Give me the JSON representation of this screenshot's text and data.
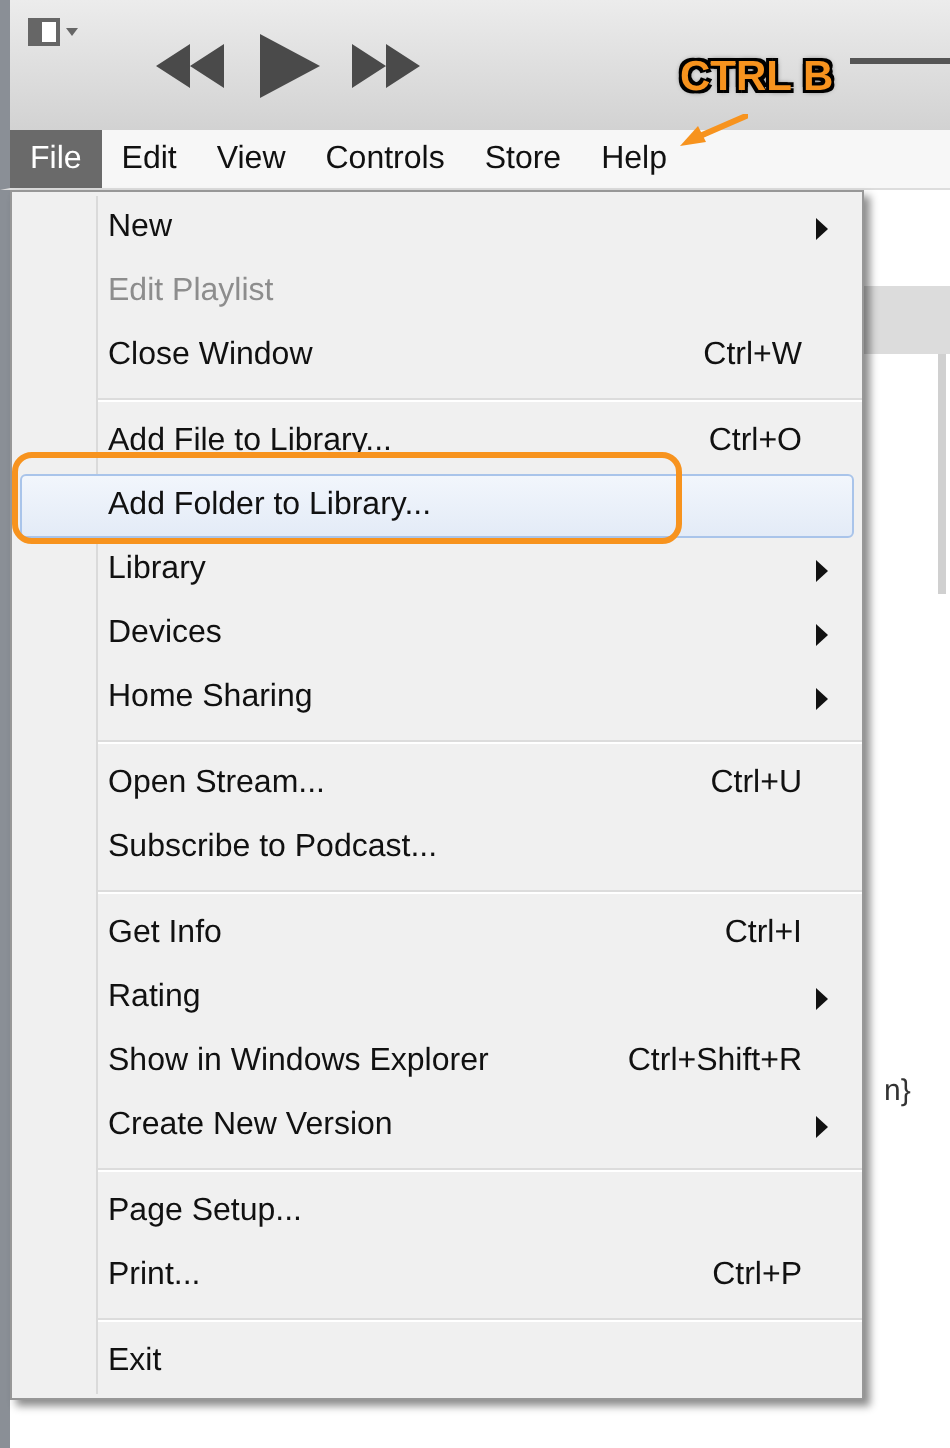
{
  "menubar": [
    {
      "label": "File",
      "selected": true
    },
    {
      "label": "Edit",
      "selected": false
    },
    {
      "label": "View",
      "selected": false
    },
    {
      "label": "Controls",
      "selected": false
    },
    {
      "label": "Store",
      "selected": false
    },
    {
      "label": "Help",
      "selected": false
    }
  ],
  "annotation": {
    "label": "CTRL B"
  },
  "menu": [
    {
      "kind": "item",
      "label": "New",
      "submenu": true,
      "disabled": false,
      "selected": false
    },
    {
      "kind": "item",
      "label": "Edit Playlist",
      "submenu": false,
      "disabled": true,
      "selected": false
    },
    {
      "kind": "item",
      "label": "Close Window",
      "shortcut": "Ctrl+W",
      "submenu": false,
      "disabled": false,
      "selected": false
    },
    {
      "kind": "separator"
    },
    {
      "kind": "item",
      "label": "Add File to Library...",
      "shortcut": "Ctrl+O",
      "submenu": false,
      "disabled": false,
      "selected": false
    },
    {
      "kind": "item",
      "label": "Add Folder to Library...",
      "submenu": false,
      "disabled": false,
      "selected": true
    },
    {
      "kind": "item",
      "label": "Library",
      "submenu": true,
      "disabled": false,
      "selected": false
    },
    {
      "kind": "item",
      "label": "Devices",
      "submenu": true,
      "disabled": false,
      "selected": false
    },
    {
      "kind": "item",
      "label": "Home Sharing",
      "submenu": true,
      "disabled": false,
      "selected": false
    },
    {
      "kind": "separator"
    },
    {
      "kind": "item",
      "label": "Open Stream...",
      "shortcut": "Ctrl+U",
      "submenu": false,
      "disabled": false,
      "selected": false
    },
    {
      "kind": "item",
      "label": "Subscribe to Podcast...",
      "submenu": false,
      "disabled": false,
      "selected": false
    },
    {
      "kind": "separator"
    },
    {
      "kind": "item",
      "label": "Get Info",
      "shortcut": "Ctrl+I",
      "submenu": false,
      "disabled": false,
      "selected": false
    },
    {
      "kind": "item",
      "label": "Rating",
      "submenu": true,
      "disabled": false,
      "selected": false
    },
    {
      "kind": "item",
      "label": "Show in Windows Explorer",
      "shortcut": "Ctrl+Shift+R",
      "submenu": false,
      "disabled": false,
      "selected": false
    },
    {
      "kind": "item",
      "label": "Create New Version",
      "submenu": true,
      "disabled": false,
      "selected": false
    },
    {
      "kind": "separator"
    },
    {
      "kind": "item",
      "label": "Page Setup...",
      "submenu": false,
      "disabled": false,
      "selected": false
    },
    {
      "kind": "item",
      "label": "Print...",
      "shortcut": "Ctrl+P",
      "submenu": false,
      "disabled": false,
      "selected": false
    },
    {
      "kind": "separator"
    },
    {
      "kind": "item",
      "label": "Exit",
      "submenu": false,
      "disabled": false,
      "selected": false
    }
  ],
  "background_text": "n}"
}
